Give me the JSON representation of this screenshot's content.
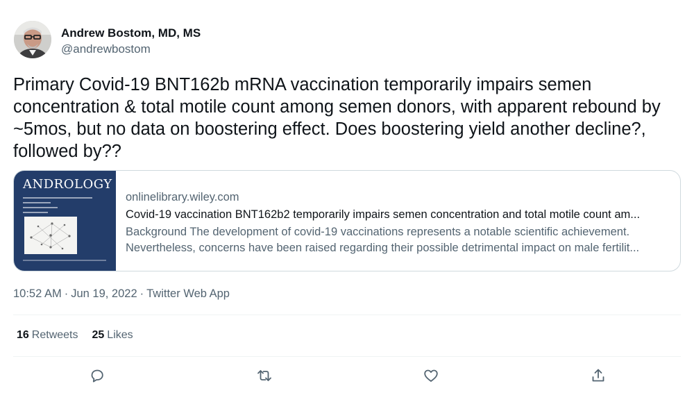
{
  "author": {
    "name": "Andrew Bostom, MD, MS",
    "handle": "@andrewbostom",
    "avatar_icon": "profile-photo"
  },
  "tweet": {
    "text": "Primary Covid-19 BNT162b mRNA vaccination temporarily impairs semen concentration & total motile count among semen donors, with apparent rebound by ~5mos, but no data on boostering effect. Does boostering yield another decline?, followed by??"
  },
  "card": {
    "thumbnail_title": "ANDROLOGY",
    "domain": "onlinelibrary.wiley.com",
    "title": "Covid-19 vaccination BNT162b2 temporarily impairs semen concentration and total motile count am...",
    "description_line1": "Background The development of covid-19 vaccinations represents a notable scientific achievement.",
    "description_line2": "Nevertheless, concerns have been raised regarding their possible detrimental impact on male fertilit...",
    "thumbnail_color": "#233d6a"
  },
  "meta": {
    "time": "10:52 AM",
    "date": "Jun 19, 2022",
    "source": "Twitter Web App",
    "separator": "·"
  },
  "stats": {
    "retweets_count": "16",
    "retweets_label": "Retweets",
    "likes_count": "25",
    "likes_label": "Likes"
  },
  "actions": {
    "reply_icon": "reply-icon",
    "retweet_icon": "retweet-icon",
    "like_icon": "heart-icon",
    "share_icon": "share-icon"
  },
  "colors": {
    "text_primary": "#0f1419",
    "text_secondary": "#536471",
    "border": "#cfd9de",
    "icon": "#536471"
  }
}
